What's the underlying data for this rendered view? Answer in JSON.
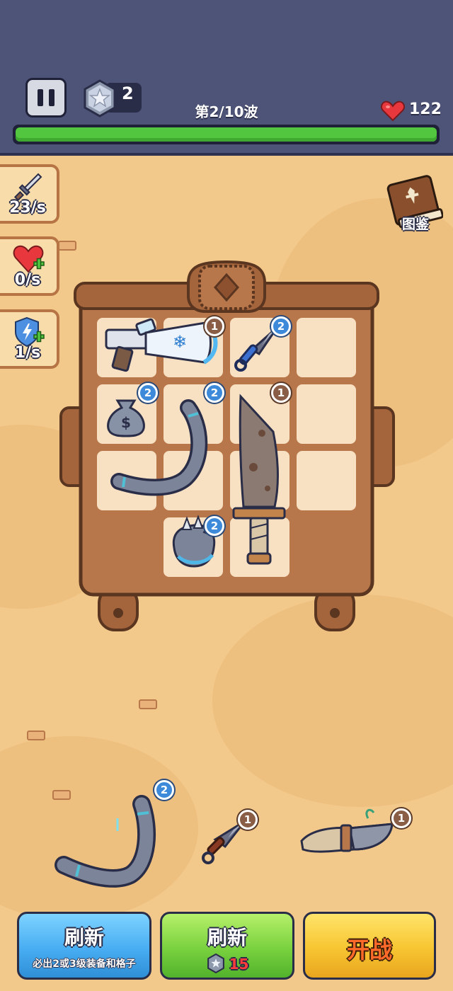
{
  "hud": {
    "gem_count": "2",
    "wave_text": "第2/10波",
    "hp_value": "122",
    "hp_fraction": 1.0,
    "icons": {
      "pause": "pause-icon",
      "gem": "star-gem-icon",
      "heart": "heart-icon"
    }
  },
  "stats": [
    {
      "name": "attack",
      "value": "23/s",
      "icon": "sword-icon"
    },
    {
      "name": "regen",
      "value": "0/s",
      "icon": "heart-plus-icon"
    },
    {
      "name": "shield",
      "value": "1/s",
      "icon": "shield-plus-icon"
    }
  ],
  "codex": {
    "label": "图鉴",
    "icon": "book-icon"
  },
  "backpack": {
    "items": [
      {
        "name": "freeze-blaster",
        "level": "1"
      },
      {
        "name": "kunai",
        "level": "2"
      },
      {
        "name": "money-bag",
        "level": "2"
      },
      {
        "name": "boomerang",
        "level": "2"
      },
      {
        "name": "rusty-machete",
        "level": "1"
      },
      {
        "name": "spiked-gauntlet",
        "level": "2"
      }
    ]
  },
  "shop": {
    "items": [
      {
        "name": "boomerang",
        "level": "2"
      },
      {
        "name": "kunai",
        "level": "1"
      },
      {
        "name": "bandaged-dagger",
        "level": "1"
      }
    ]
  },
  "buttons": {
    "refresh_premium": {
      "label": "刷新",
      "sub": "必出2或3级装备和格子"
    },
    "refresh_coin": {
      "label": "刷新",
      "cost": "15"
    },
    "start": {
      "label": "开战"
    }
  },
  "colors": {
    "hp_bar": "#52c63f",
    "accent_blue": "#48adf2",
    "accent_green": "#79d13e",
    "accent_yellow": "#f7c531"
  }
}
